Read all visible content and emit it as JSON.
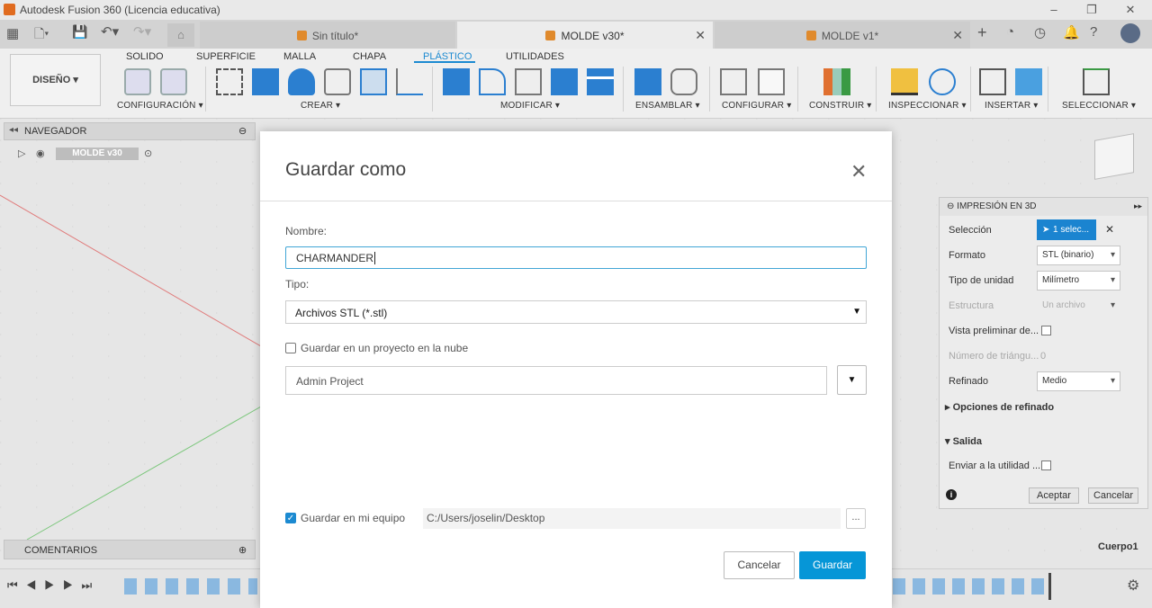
{
  "window": {
    "title": "Autodesk Fusion 360 (Licencia educativa)"
  },
  "tabs": [
    {
      "label": "Sin título*"
    },
    {
      "label": "MOLDE v30*"
    },
    {
      "label": "MOLDE v1*"
    }
  ],
  "toolbar": {
    "workspace": "DISEÑO ▾",
    "workspace_tabs": [
      "SOLIDO",
      "SUPERFICIE",
      "MALLA",
      "CHAPA",
      "PLÁSTICO",
      "UTILIDADES"
    ],
    "groups": [
      "CONFIGURACIÓN ▾",
      "CREAR ▾",
      "MODIFICAR ▾",
      "ENSAMBLAR ▾",
      "CONFIGURAR ▾",
      "CONSTRUIR ▾",
      "INSPECCIONAR ▾",
      "INSERTAR ▾",
      "SELECCIONAR ▾"
    ]
  },
  "navigator": {
    "title": "NAVEGADOR",
    "item": "MOLDE v30"
  },
  "comments": {
    "title": "COMENTARIOS"
  },
  "viewport": {
    "body_label": "Cuerpo1"
  },
  "print_panel": {
    "title": "IMPRESIÓN EN 3D",
    "rows": {
      "seleccion": "Selección",
      "seleccion_value": "1 selec...",
      "formato": "Formato",
      "formato_value": "STL (binario)",
      "tipo_unidad": "Tipo de unidad",
      "tipo_unidad_value": "Milímetro",
      "estructura": "Estructura",
      "estructura_value": "Un archivo",
      "vista": "Vista preliminar de...",
      "numero": "Número de triángu...",
      "numero_value": "0",
      "refinado": "Refinado",
      "refinado_value": "Medio",
      "opciones": "Opciones de refinado",
      "salida": "Salida",
      "enviar": "Enviar a la utilidad ..."
    },
    "ok": "Aceptar",
    "cancel": "Cancelar"
  },
  "dialog": {
    "title": "Guardar como",
    "name_label": "Nombre:",
    "name_value": "CHARMANDER",
    "type_label": "Tipo:",
    "type_value": "Archivos STL (*.stl)",
    "cloud_label": "Guardar en un proyecto en la nube",
    "project_value": "Admin Project",
    "local_label": "Guardar en mi equipo",
    "path_value": "C:/Users/joselin/Desktop",
    "browse": "...",
    "cancel": "Cancelar",
    "save": "Guardar"
  },
  "colors": {
    "accent": "#0696d7",
    "tab_active": "#1c8ad1"
  }
}
